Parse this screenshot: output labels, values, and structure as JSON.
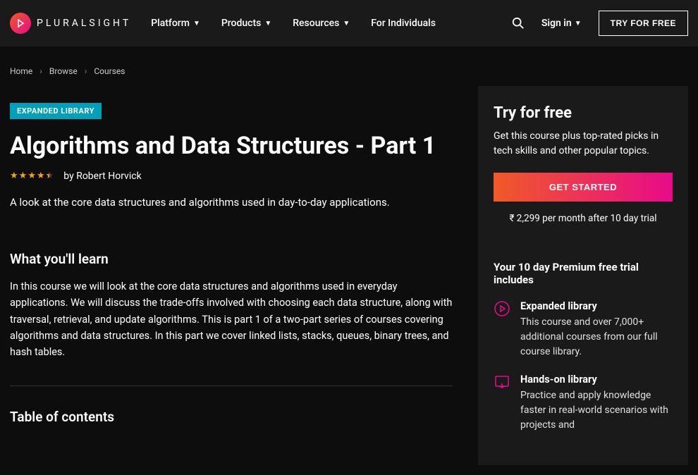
{
  "header": {
    "brand": "PLURALSIGHT",
    "nav": [
      {
        "label": "Platform",
        "dropdown": true
      },
      {
        "label": "Products",
        "dropdown": true
      },
      {
        "label": "Resources",
        "dropdown": true
      },
      {
        "label": "For Individuals",
        "dropdown": false
      }
    ],
    "signin": "Sign in",
    "try_free": "TRY FOR FREE"
  },
  "breadcrumbs": [
    "Home",
    "Browse",
    "Courses"
  ],
  "course": {
    "badge": "EXPANDED LIBRARY",
    "title": "Algorithms and Data Structures - Part 1",
    "author_by": "by",
    "author": "Robert Horvick",
    "rating": 4.5,
    "summary": "A look at the core data structures and algorithms used in day-to-day applications.",
    "learn_heading": "What you'll learn",
    "learn_body": "In this course we will look at the core data structures and algorithms used in everyday applications. We will discuss the trade-offs involved with choosing each data structure, along with traversal, retrieval, and update algorithms. This is part 1 of a two-part series of courses covering algorithms and data structures. In this part we cover linked lists, stacks, queues, binary trees, and hash tables.",
    "toc_heading": "Table of contents"
  },
  "sidebar": {
    "heading": "Try for free",
    "sub": "Get this course plus top-rated picks in tech skills and other popular topics.",
    "cta": "GET STARTED",
    "price": "₹ 2,299 per month after 10 day trial",
    "includes_heading": "Your 10 day Premium free trial includes",
    "features": [
      {
        "title": "Expanded library",
        "desc": "This course and over 7,000+ additional courses from our full course library."
      },
      {
        "title": "Hands-on library",
        "desc": "Practice and apply knowledge faster in real-world scenarios with projects and"
      }
    ]
  }
}
